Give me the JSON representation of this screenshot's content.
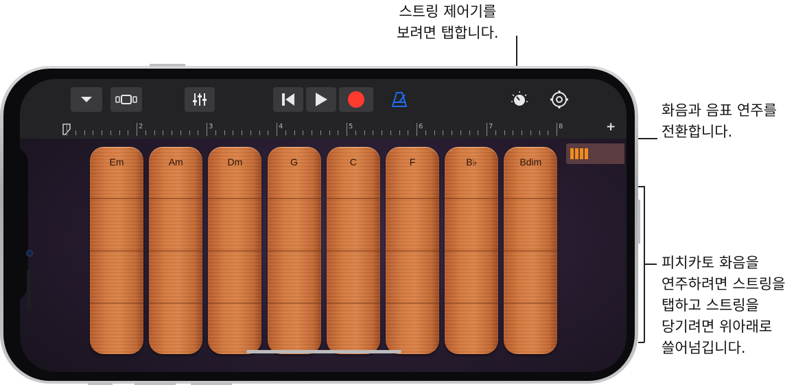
{
  "callouts": {
    "controls": "스트링 제어기를\n보려면 탭합니다.",
    "toggle": "화음과 음표 연주를\n전환합니다.",
    "pizzicato": "피치카토 화음을\n연주하려면 스트링을\n탭하고 스트링을\n당기려면 위아래로\n쓸어넘깁니다."
  },
  "toolbar": {
    "icons": [
      "chevron-down-icon",
      "browser-icon",
      "mixer-icon",
      "rewind-icon",
      "play-icon",
      "record-icon",
      "metronome-icon",
      "controls-knob-icon",
      "settings-icon"
    ],
    "accent_color": "#1e6cf0",
    "record_color": "#ff3b30"
  },
  "ruler": {
    "bar_numbers": [
      "2",
      "3",
      "4",
      "5",
      "6",
      "7",
      "8"
    ],
    "add_label": "+"
  },
  "chords": [
    "Em",
    "Am",
    "Dm",
    "G",
    "C",
    "F",
    "B♭",
    "Bdim"
  ],
  "mode_toggle": {
    "state": "chords",
    "color": "#f08c1e"
  }
}
